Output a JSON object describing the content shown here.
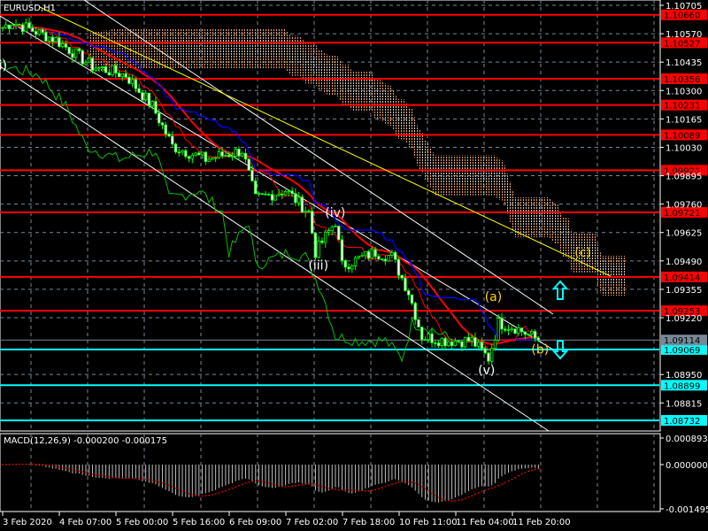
{
  "chart_data": {
    "type": "candlestick",
    "title": "EURUSD,H1",
    "symbol": "EURUSD",
    "timeframe": "H1",
    "ylim": [
      1.0865,
      1.1073
    ],
    "price_ticks": [
      "1.10705",
      "1.10570",
      "1.10435",
      "1.10300",
      "1.10165",
      "1.10030",
      "1.09895",
      "1.09760",
      "1.09625",
      "1.09490",
      "1.09355",
      "1.09220",
      "1.08950",
      "1.08815"
    ],
    "resistance_levels": [
      "1.10660",
      "1.10527",
      "1.10356",
      "1.10231",
      "1.10089",
      "1.09921",
      "1.09721",
      "1.09414",
      "1.09253"
    ],
    "support_levels": [
      "1.09069",
      "1.08899",
      "1.08732"
    ],
    "current_price": "1.09114",
    "time_labels": [
      "3 Feb 2020",
      "4 Feb 07:00",
      "5 Feb 00:00",
      "5 Feb 16:00",
      "6 Feb 09:00",
      "7 Feb 02:00",
      "7 Feb 18:00",
      "10 Feb 11:00",
      "11 Feb 04:00",
      "11 Feb 20:00"
    ],
    "close_keypoints": [
      {
        "bar": 0,
        "price": 1.106
      },
      {
        "bar": 3,
        "price": 1.10625
      },
      {
        "bar": 16,
        "price": 1.10541
      },
      {
        "bar": 27,
        "price": 1.10415
      },
      {
        "bar": 37,
        "price": 1.10373
      },
      {
        "bar": 45,
        "price": 1.10225
      },
      {
        "bar": 51,
        "price": 1.10036
      },
      {
        "bar": 61,
        "price": 1.09973
      },
      {
        "bar": 72,
        "price": 1.10015
      },
      {
        "bar": 76,
        "price": 1.09784
      },
      {
        "bar": 85,
        "price": 1.09826
      },
      {
        "bar": 92,
        "price": 1.09721
      },
      {
        "bar": 94,
        "price": 1.09531
      },
      {
        "bar": 100,
        "price": 1.09678
      },
      {
        "bar": 102,
        "price": 1.09468
      },
      {
        "bar": 112,
        "price": 1.09531
      },
      {
        "bar": 117,
        "price": 1.0951
      },
      {
        "bar": 122,
        "price": 1.09342
      },
      {
        "bar": 126,
        "price": 1.09132
      },
      {
        "bar": 133,
        "price": 1.09111
      },
      {
        "bar": 141,
        "price": 1.09111
      },
      {
        "bar": 146,
        "price": 1.09027
      },
      {
        "bar": 149,
        "price": 1.09195
      },
      {
        "bar": 154,
        "price": 1.09174
      },
      {
        "bar": 161,
        "price": 1.09114
      }
    ],
    "wave_labels": [
      {
        "text": "i)",
        "bar": 1,
        "price": 1.104
      },
      {
        "text": "(iii)",
        "bar": 94,
        "price": 1.0945
      },
      {
        "text": "(iv)",
        "bar": 99,
        "price": 1.097
      },
      {
        "text": "(v)",
        "bar": 145,
        "price": 1.0895
      },
      {
        "text": "(a)",
        "bar": 147,
        "price": 1.093
      },
      {
        "text": "(b)",
        "bar": 161,
        "price": 1.0905
      },
      {
        "text": "(c)",
        "bar": 174,
        "price": 1.0951
      }
    ],
    "macd": {
      "label": "MACD(12,26,9) -0.000200 -0.000175",
      "ticks": [
        "0.000893",
        "0.000000",
        "-0.001495"
      ],
      "ylim": [
        -0.001495,
        0.000893
      ]
    },
    "colors": {
      "candle": "#00ff00",
      "resistance": "#ff0000",
      "support": "#00ffff",
      "ma": "#ff0000",
      "kijun": "#0000ff",
      "chikou": "#00c000",
      "channel": "#ffffff",
      "trend": "#ffff00",
      "cloud": "#f4a460",
      "wave": "#ffd700"
    }
  }
}
